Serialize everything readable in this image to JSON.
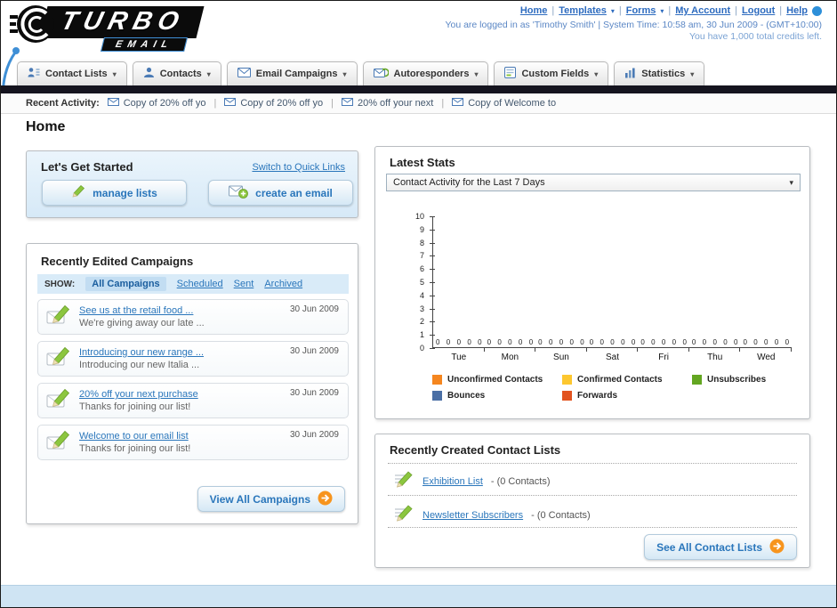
{
  "ui": {
    "dropdown_arrow": "▾",
    "separator": "|"
  },
  "header": {
    "logo_main": "TURBO",
    "logo_sub": "EMAIL",
    "links": [
      "Home",
      "Templates",
      "Forms",
      "My Account",
      "Logout",
      "Help"
    ],
    "login_status": "You are logged in as 'Timothy Smith' | System Time: 10:58 am, 30 Jun 2009 - (GMT+10:00)",
    "credits_note": "You have 1,000 total credits left."
  },
  "nav_tabs": [
    "Contact Lists",
    "Contacts",
    "Email Campaigns",
    "Autoresponders",
    "Custom Fields",
    "Statistics"
  ],
  "recent_activity": {
    "label": "Recent Activity:",
    "items": [
      "Copy of 20% off yo",
      "Copy of 20% off yo",
      "20% off your next",
      "Copy of Welcome to"
    ]
  },
  "page": {
    "title": "Home"
  },
  "get_started": {
    "title": "Let's Get Started",
    "switch_link": "Switch to Quick Links",
    "manage_lists": "manage lists",
    "create_email": "create an email"
  },
  "campaigns": {
    "title": "Recently Edited Campaigns",
    "show_label": "SHOW:",
    "tabs": [
      "All Campaigns",
      "Scheduled",
      "Sent",
      "Archived"
    ],
    "items": [
      {
        "title": "See us at the retail food ...",
        "subtitle": "We're giving away our late ...",
        "date": "30 Jun 2009"
      },
      {
        "title": "Introducing our new range ...",
        "subtitle": "Introducing our new Italia ...",
        "date": "30 Jun 2009"
      },
      {
        "title": "20% off your next purchase",
        "subtitle": "Thanks for joining our list!",
        "date": "30 Jun 2009"
      },
      {
        "title": "Welcome to our email list",
        "subtitle": "Thanks for joining our list!",
        "date": "30 Jun 2009"
      }
    ],
    "view_all": "View All Campaigns"
  },
  "stats": {
    "title": "Latest Stats",
    "period_selector": "Contact Activity for the Last 7 Days"
  },
  "chart_data": {
    "type": "bar",
    "title": "Contact Activity for the Last 7 Days",
    "categories": [
      "Tue",
      "Mon",
      "Sun",
      "Sat",
      "Fri",
      "Thu",
      "Wed"
    ],
    "series": [
      {
        "name": "Unconfirmed Contacts",
        "color": "#f5861f",
        "values": [
          0,
          0,
          0,
          0,
          0,
          0,
          0
        ]
      },
      {
        "name": "Confirmed Contacts",
        "color": "#fdc72f",
        "values": [
          0,
          0,
          0,
          0,
          0,
          0,
          0
        ]
      },
      {
        "name": "Unsubscribes",
        "color": "#63a621",
        "values": [
          0,
          0,
          0,
          0,
          0,
          0,
          0
        ]
      },
      {
        "name": "Bounces",
        "color": "#4a6fa5",
        "values": [
          0,
          0,
          0,
          0,
          0,
          0,
          0
        ]
      },
      {
        "name": "Forwards",
        "color": "#e2531f",
        "values": [
          0,
          0,
          0,
          0,
          0,
          0,
          0
        ]
      }
    ],
    "ylim": [
      0,
      10
    ],
    "grid": false,
    "legend_position": "bottom",
    "value_labels": true
  },
  "contact_lists": {
    "title": "Recently Created Contact Lists",
    "items": [
      {
        "name": "Exhibition List",
        "detail": "- (0 Contacts)"
      },
      {
        "name": "Newsletter Subscribers",
        "detail": "- (0 Contacts)"
      }
    ],
    "see_all": "See All Contact Lists"
  }
}
